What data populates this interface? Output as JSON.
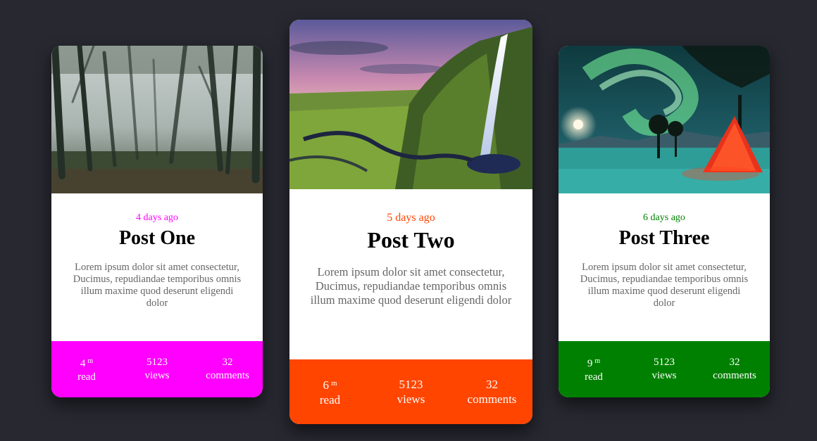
{
  "theme": {
    "page_background": "#272830"
  },
  "cards": [
    {
      "image": "misty-forest",
      "accent_color": "#ff00ff",
      "date": "4 days ago",
      "title": "Post One",
      "excerpt": "Lorem ipsum dolor sit amet consectetur, Ducimus, repudiandae temporibus omnis illum maxime quod deserunt eligendi dolor",
      "stats": {
        "read_value": "4",
        "read_unit": "m",
        "read_label": "read",
        "views_value": "5123",
        "views_label": "views",
        "comments_value": "32",
        "comments_label": "comments"
      }
    },
    {
      "image": "waterfall-valley",
      "accent_color": "#ff4500",
      "date": "5 days ago",
      "title": "Post Two",
      "excerpt": "Lorem ipsum dolor sit amet consectetur, Ducimus, repudiandae temporibus omnis illum maxime quod deserunt eligendi dolor",
      "stats": {
        "read_value": "6",
        "read_unit": "m",
        "read_label": "read",
        "views_value": "5123",
        "views_label": "views",
        "comments_value": "32",
        "comments_label": "comments"
      }
    },
    {
      "image": "aurora-tent",
      "accent_color": "#008000",
      "date": "6 days ago",
      "title": "Post Three",
      "excerpt": "Lorem ipsum dolor sit amet consectetur, Ducimus, repudiandae temporibus omnis illum maxime quod deserunt eligendi dolor",
      "stats": {
        "read_value": "9",
        "read_unit": "m",
        "read_label": "read",
        "views_value": "5123",
        "views_label": "views",
        "comments_value": "32",
        "comments_label": "comments"
      }
    }
  ]
}
